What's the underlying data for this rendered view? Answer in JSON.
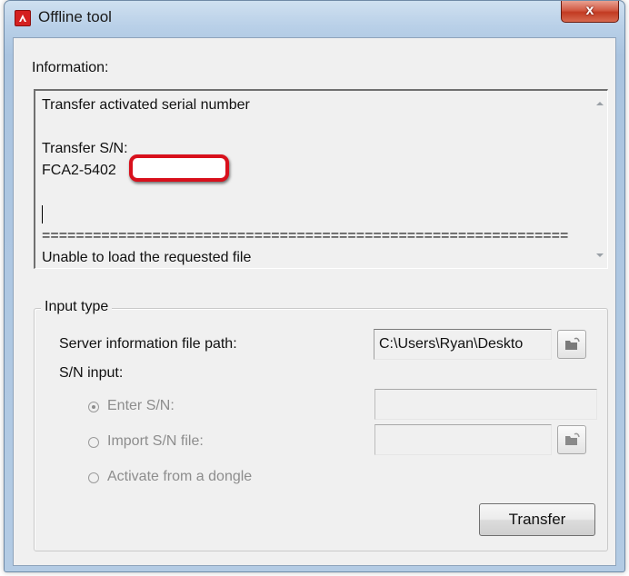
{
  "window": {
    "title": "Offline tool",
    "close_label": "x"
  },
  "information": {
    "label": "Information:",
    "lines": [
      "Transfer activated serial number",
      "",
      "Transfer S/N:",
      "FCA2-5402",
      "",
      "",
      "==============================================================",
      "Unable to load the requested file"
    ]
  },
  "input_type": {
    "group_title": "Input type",
    "server_path_label": "Server information file path:",
    "server_path_value": "C:\\Users\\Ryan\\Deskto",
    "sn_input_label": "S/N input:",
    "options": [
      {
        "label": "Enter S/N:",
        "selected": true
      },
      {
        "label": "Import S/N file:",
        "selected": false
      },
      {
        "label": "Activate from a dongle",
        "selected": false
      }
    ],
    "enter_sn_value": "",
    "import_file_value": ""
  },
  "buttons": {
    "transfer_label": "Transfer"
  },
  "colors": {
    "redaction_border": "#d8101c",
    "app_icon": "#d42020",
    "close_button": "#c23a22"
  }
}
